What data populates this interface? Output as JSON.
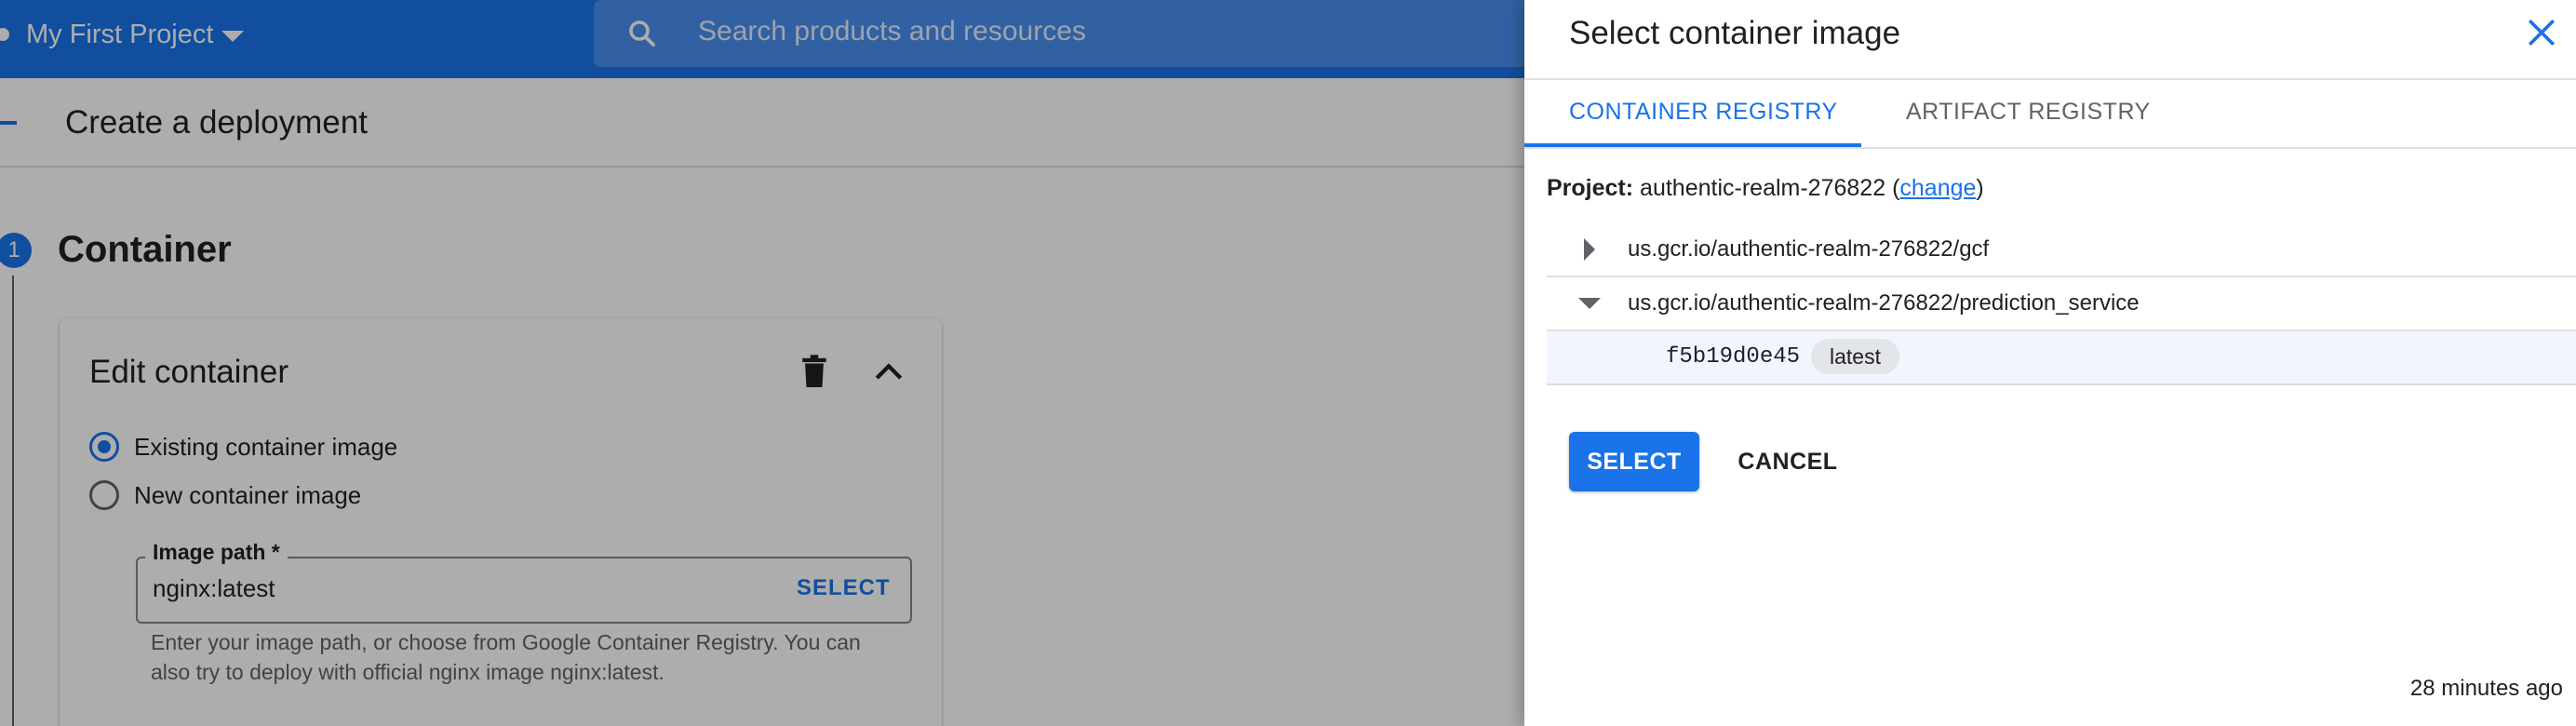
{
  "topbar": {
    "project_name": "My First Project",
    "search_placeholder": "Search products and resources"
  },
  "page": {
    "title": "Create a deployment",
    "step_number": "1",
    "step_title": "Container"
  },
  "edit_container": {
    "title": "Edit container",
    "radio_existing_label": "Existing container image",
    "radio_new_label": "New container image",
    "selected_option": "Existing container image",
    "image_path_label": "Image path *",
    "image_path_value": "nginx:latest",
    "select_label": "SELECT",
    "helper_text": "Enter your image path, or choose from Google Container Registry. You can also try to deploy with official nginx image nginx:latest."
  },
  "panel": {
    "title": "Select container image",
    "tabs": [
      {
        "label": "CONTAINER REGISTRY",
        "active": true
      },
      {
        "label": "ARTIFACT REGISTRY",
        "active": false
      }
    ],
    "project_label": "Project:",
    "project_id": "authentic-realm-276822",
    "change_link": "change",
    "repositories": [
      {
        "path": "us.gcr.io/authentic-realm-276822/gcf",
        "expanded": false
      },
      {
        "path": "us.gcr.io/authentic-realm-276822/prediction_service",
        "expanded": true
      }
    ],
    "image": {
      "digest": "f5b19d0e45",
      "tag": "latest",
      "age": "28 minutes ago"
    },
    "select_button": "SELECT",
    "cancel_button": "CANCEL"
  },
  "colors": {
    "primary": "#1a73e8",
    "text": "#202124",
    "secondary_text": "#5f6368"
  }
}
